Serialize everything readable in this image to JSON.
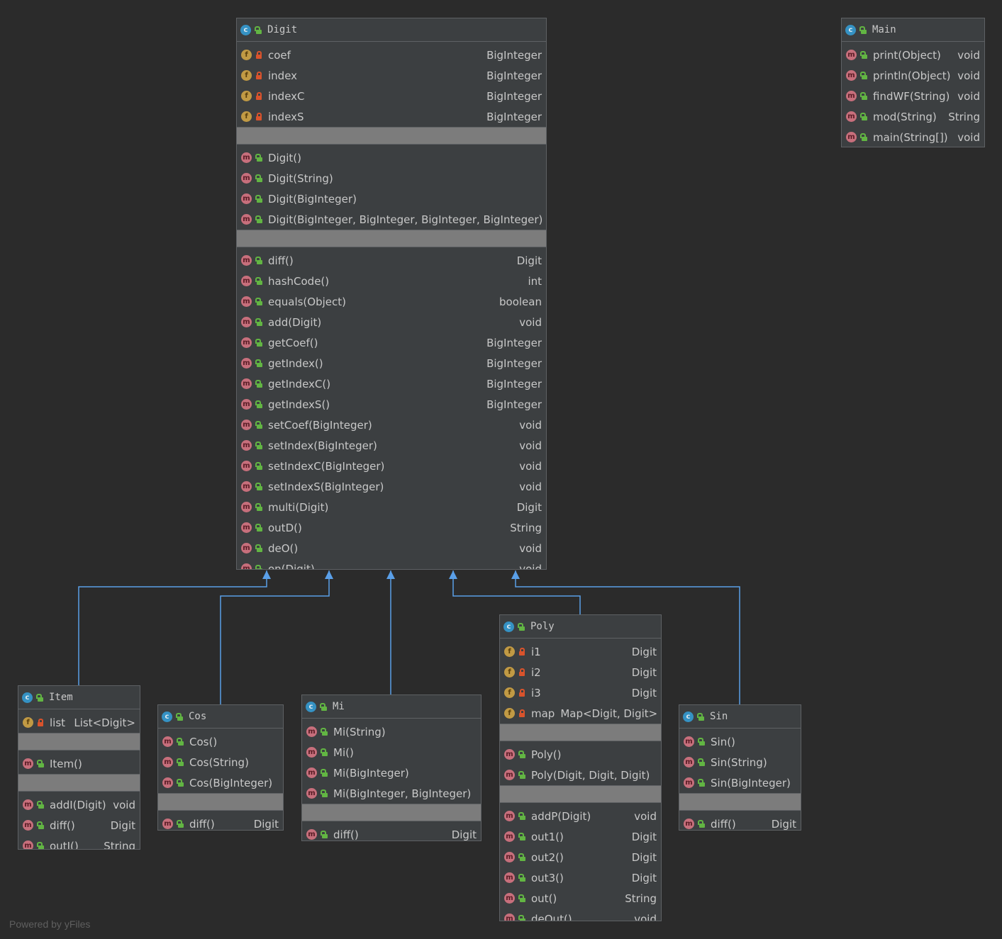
{
  "footer": "Powered by yFiles",
  "colors": {
    "background": "#2b2b2b",
    "edge": "#5a9fe8",
    "classIcon": "#3592c4",
    "fieldIcon": "#c19a44",
    "methodIcon": "#c76f7c"
  },
  "classes": {
    "digit": {
      "name": "Digit",
      "fields": [
        {
          "name": "coef",
          "type": "BigInteger"
        },
        {
          "name": "index",
          "type": "BigInteger"
        },
        {
          "name": "indexC",
          "type": "BigInteger"
        },
        {
          "name": "indexS",
          "type": "BigInteger"
        }
      ],
      "constructors": [
        {
          "name": "Digit()"
        },
        {
          "name": "Digit(String)"
        },
        {
          "name": "Digit(BigInteger)"
        },
        {
          "name": "Digit(BigInteger, BigInteger, BigInteger, BigInteger)"
        }
      ],
      "methods": [
        {
          "name": "diff()",
          "type": "Digit"
        },
        {
          "name": "hashCode()",
          "type": "int"
        },
        {
          "name": "equals(Object)",
          "type": "boolean"
        },
        {
          "name": "add(Digit)",
          "type": "void"
        },
        {
          "name": "getCoef()",
          "type": "BigInteger"
        },
        {
          "name": "getIndex()",
          "type": "BigInteger"
        },
        {
          "name": "getIndexC()",
          "type": "BigInteger"
        },
        {
          "name": "getIndexS()",
          "type": "BigInteger"
        },
        {
          "name": "setCoef(BigInteger)",
          "type": "void"
        },
        {
          "name": "setIndex(BigInteger)",
          "type": "void"
        },
        {
          "name": "setIndexC(BigInteger)",
          "type": "void"
        },
        {
          "name": "setIndexS(BigInteger)",
          "type": "void"
        },
        {
          "name": "multi(Digit)",
          "type": "Digit"
        },
        {
          "name": "outD()",
          "type": "String"
        },
        {
          "name": "deO()",
          "type": "void"
        },
        {
          "name": "on(Digit)",
          "type": "void"
        }
      ]
    },
    "main": {
      "name": "Main",
      "methods": [
        {
          "name": "print(Object)",
          "type": "void"
        },
        {
          "name": "println(Object)",
          "type": "void"
        },
        {
          "name": "findWF(String)",
          "type": "void"
        },
        {
          "name": "mod(String)",
          "type": "String"
        },
        {
          "name": "main(String[])",
          "type": "void"
        }
      ]
    },
    "item": {
      "name": "Item",
      "fields": [
        {
          "name": "list",
          "type": "List<Digit>"
        }
      ],
      "constructors": [
        {
          "name": "Item()"
        }
      ],
      "methods": [
        {
          "name": "addI(Digit)",
          "type": "void"
        },
        {
          "name": "diff()",
          "type": "Digit"
        },
        {
          "name": "outI()",
          "type": "String"
        }
      ]
    },
    "cos": {
      "name": "Cos",
      "constructors": [
        {
          "name": "Cos()"
        },
        {
          "name": "Cos(String)"
        },
        {
          "name": "Cos(BigInteger)"
        }
      ],
      "methods": [
        {
          "name": "diff()",
          "type": "Digit"
        }
      ]
    },
    "mi": {
      "name": "Mi",
      "constructors": [
        {
          "name": "Mi(String)"
        },
        {
          "name": "Mi()"
        },
        {
          "name": "Mi(BigInteger)"
        },
        {
          "name": "Mi(BigInteger, BigInteger)"
        }
      ],
      "methods": [
        {
          "name": "diff()",
          "type": "Digit"
        }
      ]
    },
    "poly": {
      "name": "Poly",
      "fields": [
        {
          "name": "i1",
          "type": "Digit"
        },
        {
          "name": "i2",
          "type": "Digit"
        },
        {
          "name": "i3",
          "type": "Digit"
        },
        {
          "name": "map",
          "type": "Map<Digit, Digit>"
        }
      ],
      "constructors": [
        {
          "name": "Poly()"
        },
        {
          "name": "Poly(Digit, Digit, Digit)"
        }
      ],
      "methods": [
        {
          "name": "addP(Digit)",
          "type": "void"
        },
        {
          "name": "out1()",
          "type": "Digit"
        },
        {
          "name": "out2()",
          "type": "Digit"
        },
        {
          "name": "out3()",
          "type": "Digit"
        },
        {
          "name": "out()",
          "type": "String"
        },
        {
          "name": "deOut()",
          "type": "void"
        }
      ]
    },
    "sin": {
      "name": "Sin",
      "constructors": [
        {
          "name": "Sin()"
        },
        {
          "name": "Sin(String)"
        },
        {
          "name": "Sin(BigInteger)"
        }
      ],
      "methods": [
        {
          "name": "diff()",
          "type": "Digit"
        }
      ]
    }
  }
}
